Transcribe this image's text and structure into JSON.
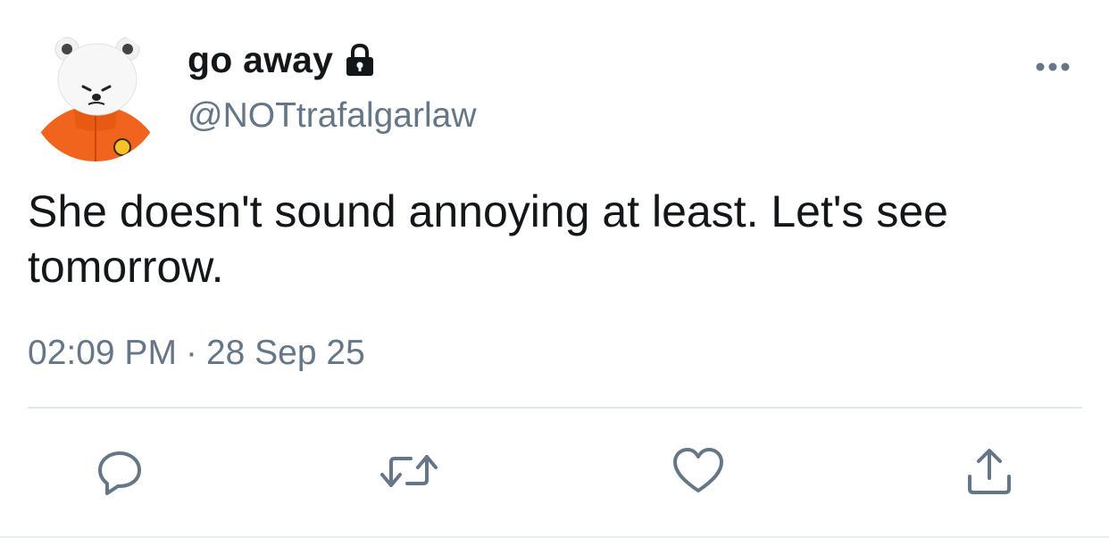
{
  "tweet": {
    "display_name": "go away",
    "handle": "@NOTtrafalgarlaw",
    "protected_icon": "lock-icon",
    "text": "She doesn't sound annoying at least. Let's see tomorrow.",
    "time": "02:09 PM",
    "separator": "·",
    "date": "28 Sep 25"
  },
  "actions": {
    "reply_icon": "reply-icon",
    "retweet_icon": "retweet-icon",
    "like_icon": "heart-icon",
    "share_icon": "share-icon",
    "more_icon": "more-icon"
  },
  "colors": {
    "text_primary": "#14171a",
    "text_secondary": "#657786",
    "icon": "#657786",
    "divider": "#e1e8ed",
    "avatar_jacket": "#f0641e"
  }
}
